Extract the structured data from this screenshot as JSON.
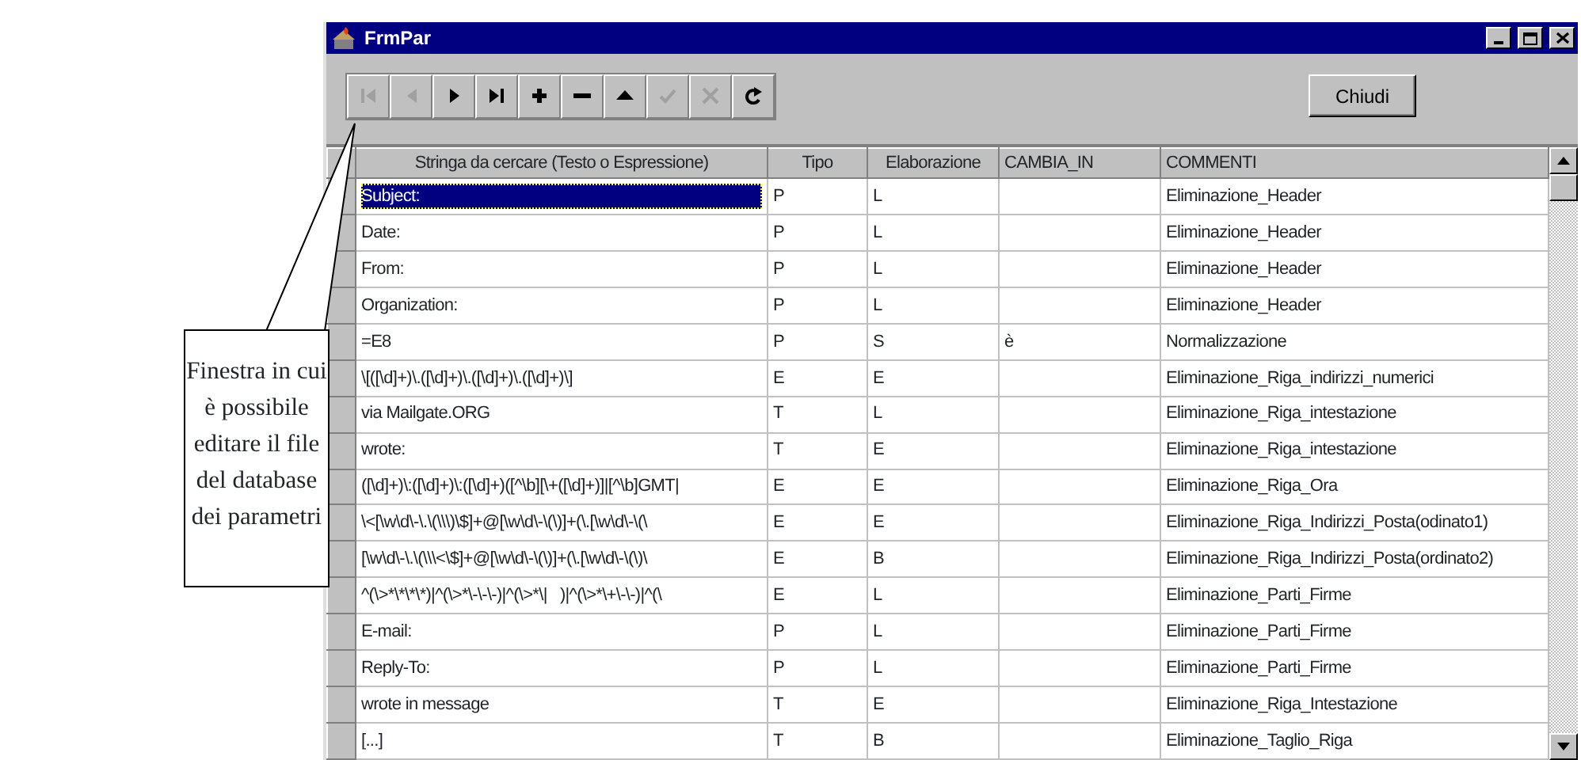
{
  "window": {
    "title": "FrmPar"
  },
  "toolbar": [
    {
      "kind": "first",
      "disabled": true
    },
    {
      "kind": "prev",
      "disabled": true
    },
    {
      "kind": "next",
      "disabled": false
    },
    {
      "kind": "last",
      "disabled": false
    },
    {
      "kind": "add",
      "disabled": false
    },
    {
      "kind": "delete",
      "disabled": false
    },
    {
      "kind": "edit",
      "disabled": false
    },
    {
      "kind": "save",
      "disabled": true
    },
    {
      "kind": "cancel",
      "disabled": true
    },
    {
      "kind": "refresh",
      "disabled": false
    }
  ],
  "close_button": "Chiudi",
  "table": {
    "columns": [
      "Stringa da cercare (Testo o Espressione)",
      "Tipo",
      "Elaborazione",
      "CAMBIA_IN",
      "COMMENTI"
    ],
    "rows": [
      {
        "selected": true,
        "cells": [
          "Subject:",
          "P",
          "L",
          "",
          "Eliminazione_Header"
        ]
      },
      {
        "selected": false,
        "cells": [
          "Date:",
          "P",
          "L",
          "",
          "Eliminazione_Header"
        ]
      },
      {
        "selected": false,
        "cells": [
          "From:",
          "P",
          "L",
          "",
          "Eliminazione_Header"
        ]
      },
      {
        "selected": false,
        "cells": [
          "Organization:",
          "P",
          "L",
          "",
          "Eliminazione_Header"
        ]
      },
      {
        "selected": false,
        "cells": [
          "=E8",
          "P",
          "S",
          "è",
          "Normalizzazione"
        ]
      },
      {
        "selected": false,
        "cells": [
          "\\[([\\d]+)\\.([\\d]+)\\.([\\d]+)\\.([\\d]+)\\]",
          "E",
          "E",
          "",
          "Eliminazione_Riga_indirizzi_numerici"
        ]
      },
      {
        "selected": false,
        "cells": [
          "via Mailgate.ORG",
          "T",
          "L",
          "",
          "Eliminazione_Riga_intestazione"
        ]
      },
      {
        "selected": false,
        "cells": [
          "wrote:",
          "T",
          "E",
          "",
          "Eliminazione_Riga_intestazione"
        ]
      },
      {
        "selected": false,
        "cells": [
          "([\\d]+)\\:([\\d]+)\\:([\\d]+)([^\\b][\\+([\\d]+)]|[^\\b]GMT|",
          "E",
          "E",
          "",
          "Eliminazione_Riga_Ora"
        ]
      },
      {
        "selected": false,
        "cells": [
          "\\<[\\w\\d\\-\\.\\(\\\\\\)\\$]+@[\\w\\d\\-\\(\\)]+(\\.[\\w\\d\\-\\(\\",
          "E",
          "E",
          "",
          "Eliminazione_Riga_Indirizzi_Posta(odinato1)"
        ]
      },
      {
        "selected": false,
        "cells": [
          "[\\w\\d\\-\\.\\(\\\\\\<\\$]+@[\\w\\d\\-\\(\\)]+(\\.[\\w\\d\\-\\(\\)\\",
          "E",
          "B",
          "",
          "Eliminazione_Riga_Indirizzi_Posta(ordinato2)"
        ]
      },
      {
        "selected": false,
        "cells": [
          "^(\\>*\\*\\*\\*)|^(\\>*\\-\\-\\-)|^(\\>*\\|   )|^(\\>*\\+\\-\\-)|^(\\",
          "E",
          "L",
          "",
          "Eliminazione_Parti_Firme"
        ]
      },
      {
        "selected": false,
        "cells": [
          "E-mail:",
          "P",
          "L",
          "",
          "Eliminazione_Parti_Firme"
        ]
      },
      {
        "selected": false,
        "cells": [
          "Reply-To:",
          "P",
          "L",
          "",
          "Eliminazione_Parti_Firme"
        ]
      },
      {
        "selected": false,
        "cells": [
          "wrote in message",
          "T",
          "E",
          "",
          "Eliminazione_Riga_Intestazione"
        ]
      },
      {
        "selected": false,
        "cells": [
          "[...]",
          "T",
          "B",
          "",
          "Eliminazione_Taglio_Riga"
        ]
      }
    ]
  },
  "callout": {
    "text": "Finestra in cui è possibile editare il file del database dei parametri"
  }
}
